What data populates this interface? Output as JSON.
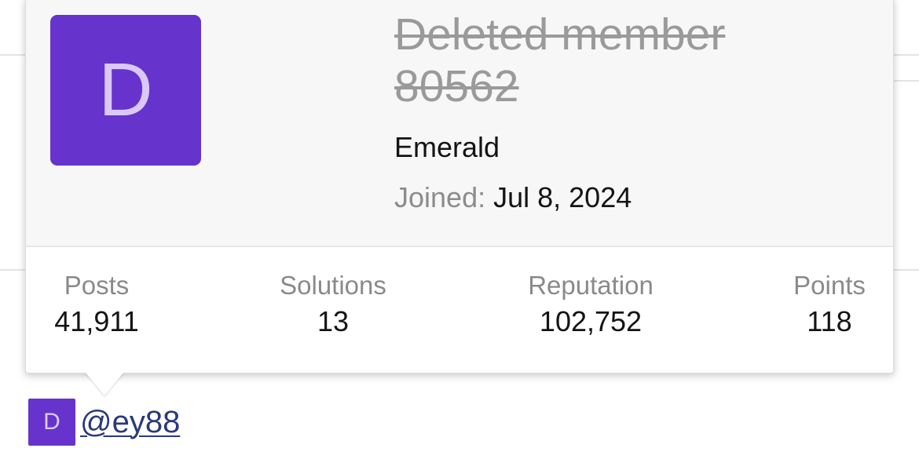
{
  "tooltip": {
    "avatar_letter": "D",
    "username": "Deleted member 80562",
    "user_title": "Emerald",
    "joined_label": "Joined:",
    "joined_value": "Jul 8, 2024",
    "stats": {
      "posts": {
        "label": "Posts",
        "value": "41,911"
      },
      "solutions": {
        "label": "Solutions",
        "value": "13"
      },
      "reputation": {
        "label": "Reputation",
        "value": "102,752"
      },
      "points": {
        "label": "Points",
        "value": "118"
      }
    }
  },
  "mention": {
    "avatar_letter": "D",
    "link_text": "@ey88"
  },
  "colors": {
    "avatar_bg": "#6633cc",
    "avatar_text": "#d8c9f5",
    "link": "#2a3a7a"
  }
}
